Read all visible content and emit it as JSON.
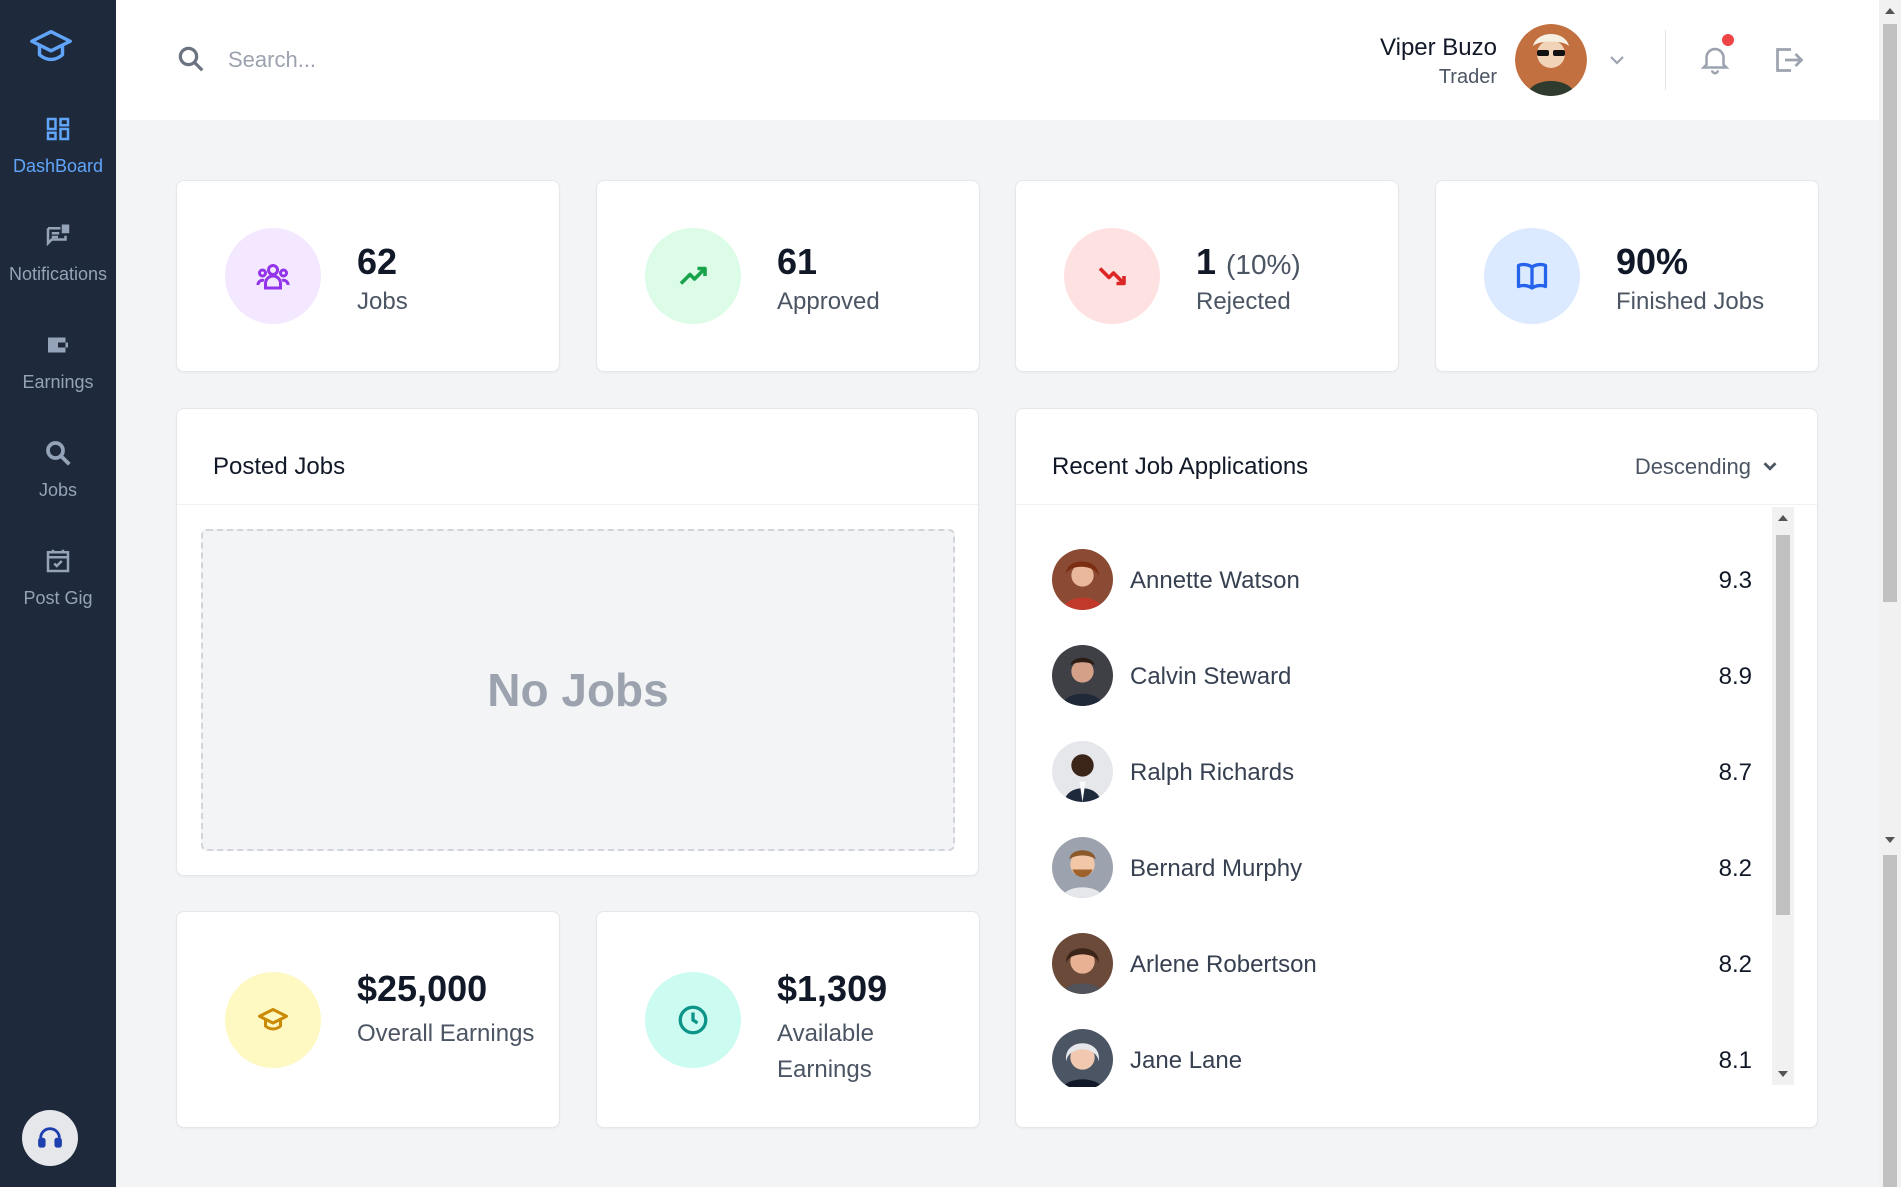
{
  "sidebar": {
    "items": [
      {
        "label": "DashBoard",
        "icon": "dashboard-icon",
        "active": true
      },
      {
        "label": "Notifications",
        "icon": "notifications-icon",
        "active": false
      },
      {
        "label": "Earnings",
        "icon": "wallet-icon",
        "active": false
      },
      {
        "label": "Jobs",
        "icon": "search-icon",
        "active": false
      },
      {
        "label": "Post Gig",
        "icon": "calendar-check-icon",
        "active": false
      }
    ],
    "logo_icon": "graduation-cap-icon",
    "support_icon": "headset-icon"
  },
  "header": {
    "search_placeholder": "Search...",
    "user": {
      "name": "Viper Buzo",
      "role": "Trader"
    }
  },
  "stats": [
    {
      "value": "62",
      "value_sub": "",
      "label": "Jobs",
      "icon": "users-icon",
      "bg": "#f3e8ff",
      "fg": "#9333ea"
    },
    {
      "value": "61",
      "value_sub": "",
      "label": "Approved",
      "icon": "trending-up-icon",
      "bg": "#dcfce7",
      "fg": "#16a34a"
    },
    {
      "value": "1",
      "value_sub": "(10%)",
      "label": "Rejected",
      "icon": "trending-down-icon",
      "bg": "#fee2e2",
      "fg": "#dc2626"
    },
    {
      "value": "90%",
      "value_sub": "",
      "label": "Finished Jobs",
      "icon": "book-open-icon",
      "bg": "#dbeafe",
      "fg": "#2563eb"
    }
  ],
  "posted_jobs": {
    "title": "Posted Jobs",
    "empty_text": "No Jobs"
  },
  "recent_apps": {
    "title": "Recent Job Applications",
    "sort": "Descending",
    "rows": [
      {
        "name": "Annette Watson",
        "score": "9.3"
      },
      {
        "name": "Calvin Steward",
        "score": "8.9"
      },
      {
        "name": "Ralph Richards",
        "score": "8.7"
      },
      {
        "name": "Bernard Murphy",
        "score": "8.2"
      },
      {
        "name": "Arlene Robertson",
        "score": "8.2"
      },
      {
        "name": "Jane Lane",
        "score": "8.1"
      }
    ]
  },
  "earnings": [
    {
      "value": "$25,000",
      "label": "Overall Earnings",
      "icon": "graduation-cap-icon",
      "bg": "#fef9c3",
      "fg": "#ca8a04"
    },
    {
      "value": "$1,309",
      "label": "Available Earnings",
      "icon": "clock-icon",
      "bg": "#ccfbf1",
      "fg": "#0d9488"
    }
  ]
}
